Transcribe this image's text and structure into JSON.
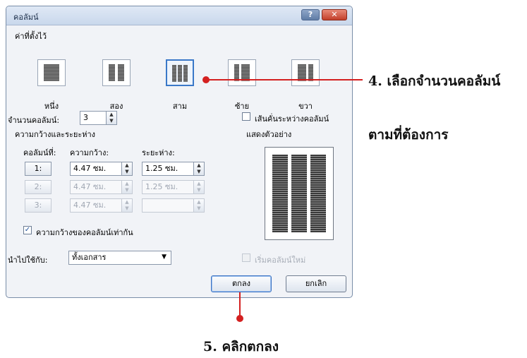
{
  "dialog": {
    "title": "คอลัมน์",
    "help_button": "?",
    "close_button": "✕",
    "presets_label": "ค่าที่ตั้งไว้",
    "presets": [
      {
        "label": "หนึ่ง",
        "icon": "one-column-icon"
      },
      {
        "label": "สอง",
        "icon": "two-column-icon"
      },
      {
        "label": "สาม",
        "icon": "three-column-icon",
        "selected": true
      },
      {
        "label": "ซ้าย",
        "icon": "left-column-icon"
      },
      {
        "label": "ขวา",
        "icon": "right-column-icon"
      }
    ],
    "num_columns_label": "จำนวนคอลัมน์:",
    "num_columns_value": "3",
    "line_between_label": "เส้นคั่นระหว่างคอลัมน์",
    "width_spacing_label": "ความกว้างและระยะห่าง",
    "preview_label": "แสดงตัวอย่าง",
    "col_header": "คอลัมน์ที่:",
    "width_header": "ความกว้าง:",
    "spacing_header": "ระยะห่าง:",
    "rows": [
      {
        "col": "1:",
        "width": "4.47 ซม.",
        "spacing": "1.25 ซม.",
        "enabled": true
      },
      {
        "col": "2:",
        "width": "4.47 ซม.",
        "spacing": "1.25 ซม.",
        "enabled": false
      },
      {
        "col": "3:",
        "width": "4.47 ซม.",
        "spacing": "",
        "enabled": false
      }
    ],
    "equal_width_label": "ความกว้างของคอลัมน์เท่ากัน",
    "equal_width_checked": true,
    "apply_to_label": "นำไปใช้กับ:",
    "apply_to_value": "ทั้งเอกสาร",
    "new_column_label": "เริ่มคอลัมน์ใหม่",
    "ok_label": "ตกลง",
    "cancel_label": "ยกเลิก"
  },
  "annotations": {
    "step4_line1": "4. เลือกจำนวนคอลัมน์",
    "step4_line2": "ตามที่ต้องการ",
    "step5": "5. คลิกตกลง",
    "accent_color": "#d42020"
  }
}
